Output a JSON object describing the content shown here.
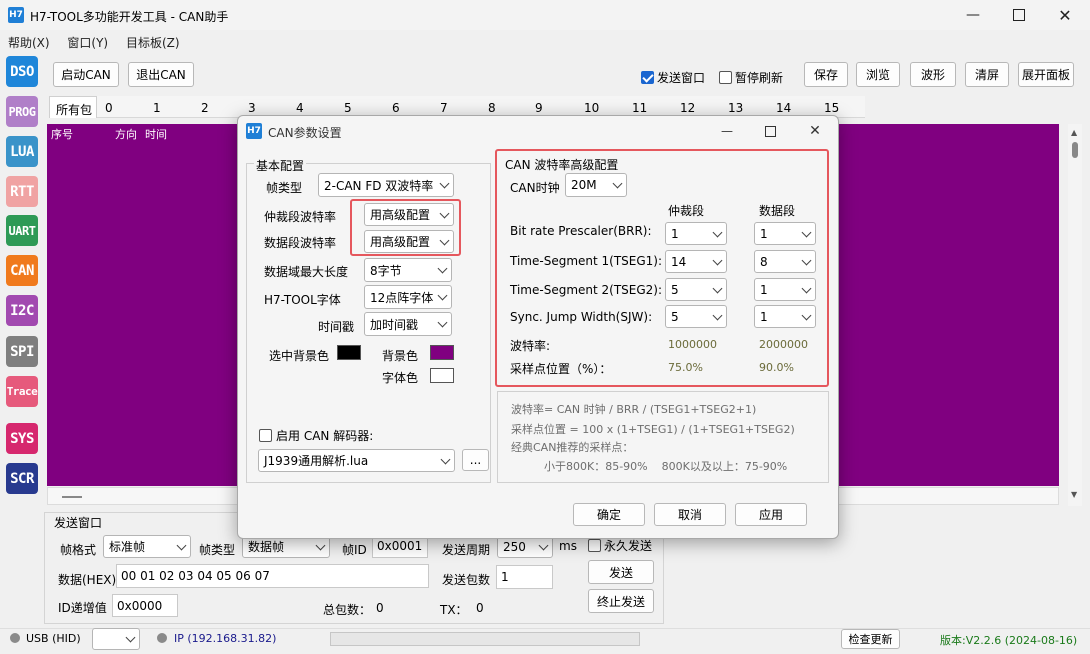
{
  "window": {
    "logo": "H7",
    "title": "H7-TOOL多功能开发工具 - CAN助手"
  },
  "menu": [
    "帮助(X)",
    "窗口(Y)",
    "目标板(Z)"
  ],
  "sidebar": [
    {
      "label": "DSO",
      "color": "#1f86d9"
    },
    {
      "label": "PROG",
      "color": "#b07fc8"
    },
    {
      "label": "LUA",
      "color": "#3a93c9"
    },
    {
      "label": "RTT",
      "color": "#f0a3a3"
    },
    {
      "label": "UART",
      "color": "#2e9a56"
    },
    {
      "label": "CAN",
      "color": "#f07a1c"
    },
    {
      "label": "I2C",
      "color": "#a24ab0"
    },
    {
      "label": "SPI",
      "color": "#7f7f7f"
    },
    {
      "label": "Trace",
      "color": "#e65a7c"
    },
    {
      "label": "SYS",
      "color": "#d6286e"
    },
    {
      "label": "SCR",
      "color": "#283a8f"
    }
  ],
  "toolbar": {
    "start_can": "启动CAN",
    "exit_can": "退出CAN",
    "send_window": "发送窗口",
    "pause_refresh": "暂停刷新",
    "save": "保存",
    "browse": "浏览",
    "wave": "波形",
    "clear": "清屏",
    "expand": "展开面板"
  },
  "tabs": [
    "所有包",
    "0",
    "1",
    "2",
    "3",
    "4",
    "5",
    "6",
    "7",
    "8",
    "9",
    "10",
    "11",
    "12",
    "13",
    "14",
    "15"
  ],
  "table_headers": [
    "序号",
    "方向",
    "时间"
  ],
  "colors": {
    "table_bg": "#800080",
    "accent_red": "#e5575d"
  },
  "send_panel": {
    "title": "发送窗口",
    "frame_format_label": "帧格式",
    "frame_format_value": "标准帧",
    "frame_type_label": "帧类型",
    "frame_type_value": "数据帧",
    "frame_id_label": "帧ID",
    "frame_id_value": "0x0001",
    "period_label": "发送周期",
    "period_value": "250",
    "period_unit": "ms",
    "forever_send": "永久发送",
    "data_label": "数据(HEX)",
    "data_value": "00 01 02 03 04 05 06 07",
    "count_label": "发送包数",
    "count_value": "1",
    "send_btn": "发送",
    "id_inc_label": "ID递增值",
    "id_inc_value": "0x0000",
    "total_label": "总包数：",
    "total_value": "0",
    "tx_label": "TX：",
    "tx_value": "0",
    "stop_btn": "终止发送"
  },
  "status": {
    "usb": "USB (HID)",
    "ip": "IP (192.168.31.82)",
    "check_update": "检查更新",
    "version": "版本:V2.2.6 (2024-08-16)"
  },
  "dialog": {
    "logo": "H7",
    "title": "CAN参数设置",
    "basic": {
      "title": "基本配置",
      "frame_type_label": "帧类型",
      "frame_type_value": "2-CAN FD 双波特率",
      "arb_rate_label": "仲裁段波特率",
      "arb_rate_value": "用高级配置",
      "data_rate_label": "数据段波特率",
      "data_rate_value": "用高级配置",
      "max_len_label": "数据域最大长度",
      "max_len_value": "8字节",
      "font_label": "H7-TOOL字体",
      "font_value": "12点阵字体",
      "timestamp_label": "时间戳",
      "timestamp_value": "加时间戳",
      "sel_bg_label": "选中背景色",
      "bg_label": "背景色",
      "font_color_label": "字体色",
      "decoder_label": "启用 CAN 解码器:",
      "decoder_value": "J1939通用解析.lua",
      "browse": "..."
    },
    "advanced": {
      "title": "CAN 波特率高级配置",
      "clock_label": "CAN时钟",
      "clock_value": "20M",
      "col_arb": "仲裁段",
      "col_data": "数据段",
      "rows": [
        {
          "label": "Bit rate  Prescaler(BRR):",
          "arb": "1",
          "data": "1"
        },
        {
          "label": "Time-Segment 1(TSEG1):",
          "arb": "14",
          "data": "8"
        },
        {
          "label": "Time-Segment 2(TSEG2):",
          "arb": "5",
          "data": "1"
        },
        {
          "label": "Sync. Jump Width(SJW):",
          "arb": "5",
          "data": "1"
        }
      ],
      "rate_label": "波特率:",
      "rate_arb": "1000000",
      "rate_data": "2000000",
      "sample_label": "采样点位置（%）：",
      "sample_arb": "75.0%",
      "sample_data": "90.0%"
    },
    "formula": {
      "l1": "波特率= CAN 时钟 / BRR / (TSEG1+TSEG2+1)",
      "l2": "采样点位置 = 100 x (1+TSEG1) / (1+TSEG1+TSEG2)",
      "l3": "经典CAN推荐的采样点：",
      "l4": "小于800K：85-90%    800K以及以上：75-90%"
    },
    "ok": "确定",
    "cancel": "取消",
    "apply": "应用"
  }
}
